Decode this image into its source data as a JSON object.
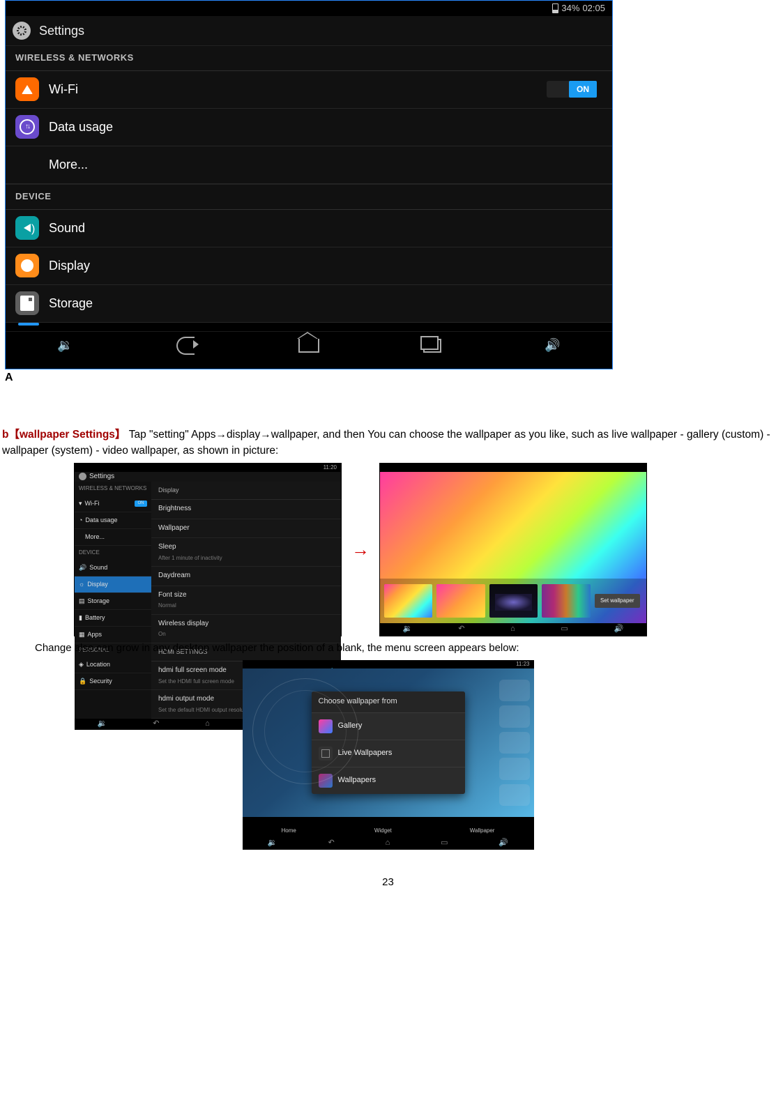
{
  "status": {
    "battery": "34%",
    "time": "02:05"
  },
  "app_title": "Settings",
  "sections": {
    "wireless": "WIRELESS & NETWORKS",
    "device": "DEVICE"
  },
  "rows": {
    "wifi": "Wi-Fi",
    "wifi_toggle": "ON",
    "data_usage": "Data usage",
    "more": "More...",
    "sound": "Sound",
    "display": "Display",
    "storage": "Storage"
  },
  "letter_a": "A",
  "paragraph": {
    "heading": "b【wallpaper Settings】",
    "body": "   Tap \"setting\" Apps→display→wallpaper, and then You can choose the wallpaper as you like, such as live wallpaper - gallery (custom) - wallpaper (system) - video wallpaper, as shown in picture:"
  },
  "thumb1": {
    "status": "11:20",
    "title": "Settings",
    "sec_wireless": "WIRELESS & NETWORKS",
    "wifi": "Wi-Fi",
    "wifi_on": "ON",
    "data": "Data usage",
    "more": "More...",
    "sec_device": "DEVICE",
    "sound": "Sound",
    "display": "Display",
    "storage": "Storage",
    "battery": "Battery",
    "apps": "Apps",
    "sec_personal": "PERSONAL",
    "location": "Location",
    "security": "Security",
    "right_header": "Display",
    "brightness": "Brightness",
    "wallpaper": "Wallpaper",
    "sleep": "Sleep",
    "sleep_sub": "After 1 minute of inactivity",
    "daydream": "Daydream",
    "fontsize": "Font size",
    "fontsize_sub": "Normal",
    "wireless_disp": "Wireless display",
    "wireless_disp_sub": "On",
    "sec_hdmi": "HDMI SETTINGS",
    "hdmi_full": "hdmi full screen mode",
    "hdmi_full_sub": "Set the HDMI full screen mode",
    "hdmi_out": "hdmi output mode",
    "hdmi_out_sub": "Set the default HDMI output resolution"
  },
  "wallpaper_picker": {
    "set_btn": "Set wallpaper"
  },
  "caption": "Change also can grow in any desktop wallpaper the position of a blank, the menu screen appears below:",
  "chooser": {
    "status": "11:23",
    "title": "Choose wallpaper from",
    "gallery": "Gallery",
    "live": "Live Wallpapers",
    "wallpapers": "Wallpapers",
    "home": "Home",
    "widget": "Widget",
    "wallpaper": "Wallpaper"
  },
  "page_number": "23"
}
